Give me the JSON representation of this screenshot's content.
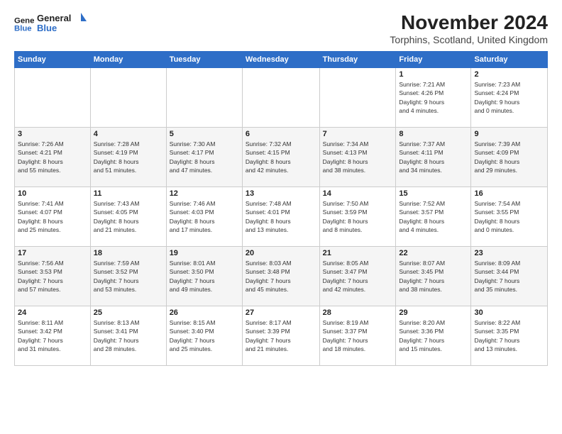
{
  "logo": {
    "line1": "General",
    "line2": "Blue"
  },
  "title": "November 2024",
  "location": "Torphins, Scotland, United Kingdom",
  "days_of_week": [
    "Sunday",
    "Monday",
    "Tuesday",
    "Wednesday",
    "Thursday",
    "Friday",
    "Saturday"
  ],
  "weeks": [
    [
      {
        "day": "",
        "info": ""
      },
      {
        "day": "",
        "info": ""
      },
      {
        "day": "",
        "info": ""
      },
      {
        "day": "",
        "info": ""
      },
      {
        "day": "",
        "info": ""
      },
      {
        "day": "1",
        "info": "Sunrise: 7:21 AM\nSunset: 4:26 PM\nDaylight: 9 hours\nand 4 minutes."
      },
      {
        "day": "2",
        "info": "Sunrise: 7:23 AM\nSunset: 4:24 PM\nDaylight: 9 hours\nand 0 minutes."
      }
    ],
    [
      {
        "day": "3",
        "info": "Sunrise: 7:26 AM\nSunset: 4:21 PM\nDaylight: 8 hours\nand 55 minutes."
      },
      {
        "day": "4",
        "info": "Sunrise: 7:28 AM\nSunset: 4:19 PM\nDaylight: 8 hours\nand 51 minutes."
      },
      {
        "day": "5",
        "info": "Sunrise: 7:30 AM\nSunset: 4:17 PM\nDaylight: 8 hours\nand 47 minutes."
      },
      {
        "day": "6",
        "info": "Sunrise: 7:32 AM\nSunset: 4:15 PM\nDaylight: 8 hours\nand 42 minutes."
      },
      {
        "day": "7",
        "info": "Sunrise: 7:34 AM\nSunset: 4:13 PM\nDaylight: 8 hours\nand 38 minutes."
      },
      {
        "day": "8",
        "info": "Sunrise: 7:37 AM\nSunset: 4:11 PM\nDaylight: 8 hours\nand 34 minutes."
      },
      {
        "day": "9",
        "info": "Sunrise: 7:39 AM\nSunset: 4:09 PM\nDaylight: 8 hours\nand 29 minutes."
      }
    ],
    [
      {
        "day": "10",
        "info": "Sunrise: 7:41 AM\nSunset: 4:07 PM\nDaylight: 8 hours\nand 25 minutes."
      },
      {
        "day": "11",
        "info": "Sunrise: 7:43 AM\nSunset: 4:05 PM\nDaylight: 8 hours\nand 21 minutes."
      },
      {
        "day": "12",
        "info": "Sunrise: 7:46 AM\nSunset: 4:03 PM\nDaylight: 8 hours\nand 17 minutes."
      },
      {
        "day": "13",
        "info": "Sunrise: 7:48 AM\nSunset: 4:01 PM\nDaylight: 8 hours\nand 13 minutes."
      },
      {
        "day": "14",
        "info": "Sunrise: 7:50 AM\nSunset: 3:59 PM\nDaylight: 8 hours\nand 8 minutes."
      },
      {
        "day": "15",
        "info": "Sunrise: 7:52 AM\nSunset: 3:57 PM\nDaylight: 8 hours\nand 4 minutes."
      },
      {
        "day": "16",
        "info": "Sunrise: 7:54 AM\nSunset: 3:55 PM\nDaylight: 8 hours\nand 0 minutes."
      }
    ],
    [
      {
        "day": "17",
        "info": "Sunrise: 7:56 AM\nSunset: 3:53 PM\nDaylight: 7 hours\nand 57 minutes."
      },
      {
        "day": "18",
        "info": "Sunrise: 7:59 AM\nSunset: 3:52 PM\nDaylight: 7 hours\nand 53 minutes."
      },
      {
        "day": "19",
        "info": "Sunrise: 8:01 AM\nSunset: 3:50 PM\nDaylight: 7 hours\nand 49 minutes."
      },
      {
        "day": "20",
        "info": "Sunrise: 8:03 AM\nSunset: 3:48 PM\nDaylight: 7 hours\nand 45 minutes."
      },
      {
        "day": "21",
        "info": "Sunrise: 8:05 AM\nSunset: 3:47 PM\nDaylight: 7 hours\nand 42 minutes."
      },
      {
        "day": "22",
        "info": "Sunrise: 8:07 AM\nSunset: 3:45 PM\nDaylight: 7 hours\nand 38 minutes."
      },
      {
        "day": "23",
        "info": "Sunrise: 8:09 AM\nSunset: 3:44 PM\nDaylight: 7 hours\nand 35 minutes."
      }
    ],
    [
      {
        "day": "24",
        "info": "Sunrise: 8:11 AM\nSunset: 3:42 PM\nDaylight: 7 hours\nand 31 minutes."
      },
      {
        "day": "25",
        "info": "Sunrise: 8:13 AM\nSunset: 3:41 PM\nDaylight: 7 hours\nand 28 minutes."
      },
      {
        "day": "26",
        "info": "Sunrise: 8:15 AM\nSunset: 3:40 PM\nDaylight: 7 hours\nand 25 minutes."
      },
      {
        "day": "27",
        "info": "Sunrise: 8:17 AM\nSunset: 3:39 PM\nDaylight: 7 hours\nand 21 minutes."
      },
      {
        "day": "28",
        "info": "Sunrise: 8:19 AM\nSunset: 3:37 PM\nDaylight: 7 hours\nand 18 minutes."
      },
      {
        "day": "29",
        "info": "Sunrise: 8:20 AM\nSunset: 3:36 PM\nDaylight: 7 hours\nand 15 minutes."
      },
      {
        "day": "30",
        "info": "Sunrise: 8:22 AM\nSunset: 3:35 PM\nDaylight: 7 hours\nand 13 minutes."
      }
    ]
  ],
  "colors": {
    "header_bg": "#2e6ec7",
    "logo_blue": "#2e6ec7"
  }
}
